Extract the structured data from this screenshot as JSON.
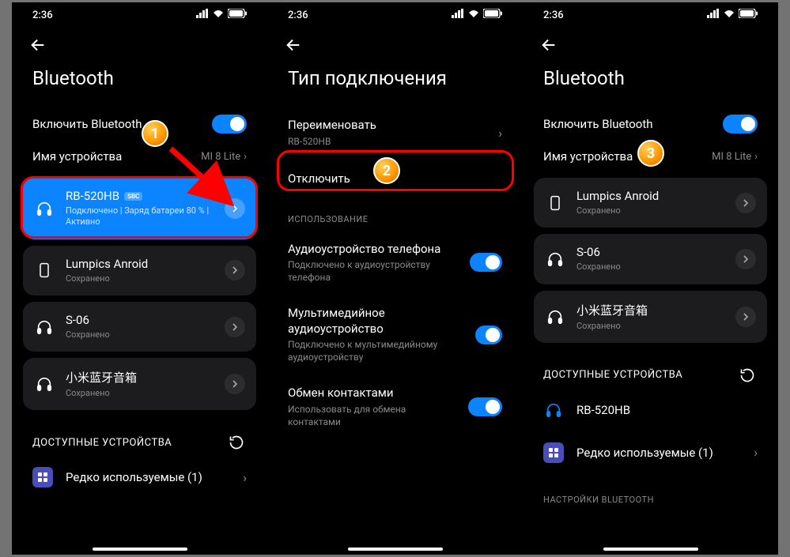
{
  "status": {
    "time": "2:36"
  },
  "screen1": {
    "title": "Bluetooth",
    "enable_label": "Включить Bluetooth",
    "devicename_label": "Имя устройства",
    "devicename_value": "MI 8 Lite",
    "devices": [
      {
        "name": "RB-520HB",
        "badge": "SBC",
        "sub": "Подключено | Заряд батареи 80 % | Активно",
        "icon": "headphones",
        "highlight": true
      },
      {
        "name": "Lumpics Anroid",
        "sub": "Сохранено",
        "icon": "phone"
      },
      {
        "name": "S-06",
        "sub": "Сохранено",
        "icon": "headphones"
      },
      {
        "name": "小米蓝牙音箱",
        "sub": "Сохранено",
        "icon": "headphones"
      }
    ],
    "available_header": "ДОСТУПНЫЕ УСТРОЙСТВА",
    "rare_label": "Редко используемые (1)"
  },
  "screen2": {
    "title": "Тип подключения",
    "rename_label": "Переименовать",
    "rename_value": "RB-520HB",
    "disconnect_label": "Отключить",
    "usage_header": "ИСПОЛЬЗОВАНИЕ",
    "rows": [
      {
        "t1": "Аудиоустройство телефона",
        "t2": "Подключено к аудиоустройству телефона"
      },
      {
        "t1": "Мультимедийное аудиоустройство",
        "t2": "Подключено к мультимедийному аудиоустройству"
      },
      {
        "t1": "Обмен контактами",
        "t2": "Использовать для обмена контактами"
      }
    ]
  },
  "screen3": {
    "title": "Bluetooth",
    "enable_label": "Включить Bluetooth",
    "devicename_label": "Имя устройства",
    "devicename_value": "MI 8 Lite",
    "devices": [
      {
        "name": "Lumpics Anroid",
        "sub": "Сохранено",
        "icon": "phone"
      },
      {
        "name": "S-06",
        "sub": "Сохранено",
        "icon": "headphones"
      },
      {
        "name": "小米蓝牙音箱",
        "sub": "Сохранено",
        "icon": "headphones"
      }
    ],
    "available_header": "ДОСТУПНЫЕ УСТРОЙСТВА",
    "available_device": "RB-520HB",
    "rare_label": "Редко используемые (1)",
    "settings_header": "НАСТРОЙКИ BLUETOOTH"
  },
  "markers": {
    "m1": "1",
    "m2": "2",
    "m3": "3"
  }
}
